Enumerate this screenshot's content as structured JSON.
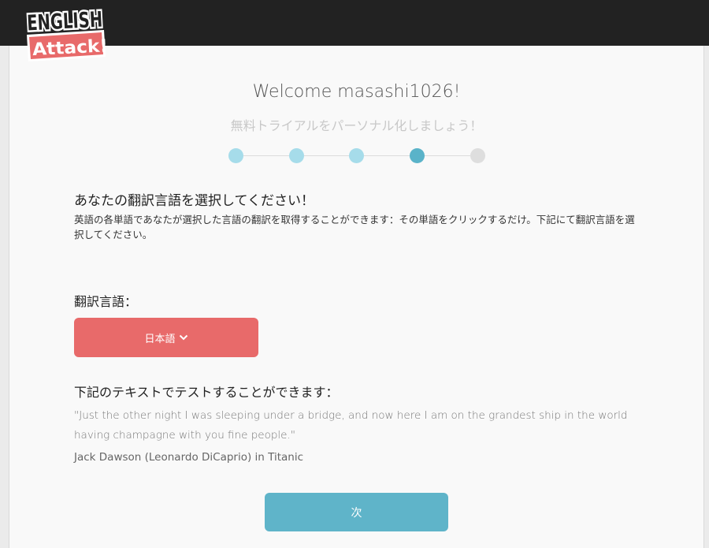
{
  "brand": {
    "logo_line1": "ENGLISH",
    "logo_line2": "Attack!",
    "logo_colors": {
      "primary": "#e86a6a",
      "outline": "#ffffff",
      "ink": "#222222"
    }
  },
  "header": {
    "welcome": "Welcome masashi1026!",
    "subtitle": "無料トライアルをパーソナル化しましょう！"
  },
  "stepper": {
    "total_steps": 5,
    "current_step": 4,
    "colors": {
      "done": "#a6dcea",
      "current": "#5ab3c9",
      "todo": "#dedede"
    }
  },
  "section": {
    "heading": "あなたの翻訳言語を選択してください！",
    "description": "英語の各単語であなたが選択した言語の翻訳を取得することができます：その単語をクリックするだけ。下記にて翻訳言語を選択してください。"
  },
  "language": {
    "label": "翻訳言語：",
    "selected": "日本語",
    "dropdown_icon": "chevron-down-icon",
    "color": "#e86a6a"
  },
  "test": {
    "heading": "下記のテキストでテストすることができます：",
    "quote": "\"Just the other night I was sleeping under a bridge, and now here I am on the grandest ship in the world having champagne with you fine people.\"",
    "source": "Jack Dawson (Leonardo DiCaprio) in Titanic"
  },
  "actions": {
    "next_label": "次",
    "next_color": "#5fb4c9"
  }
}
